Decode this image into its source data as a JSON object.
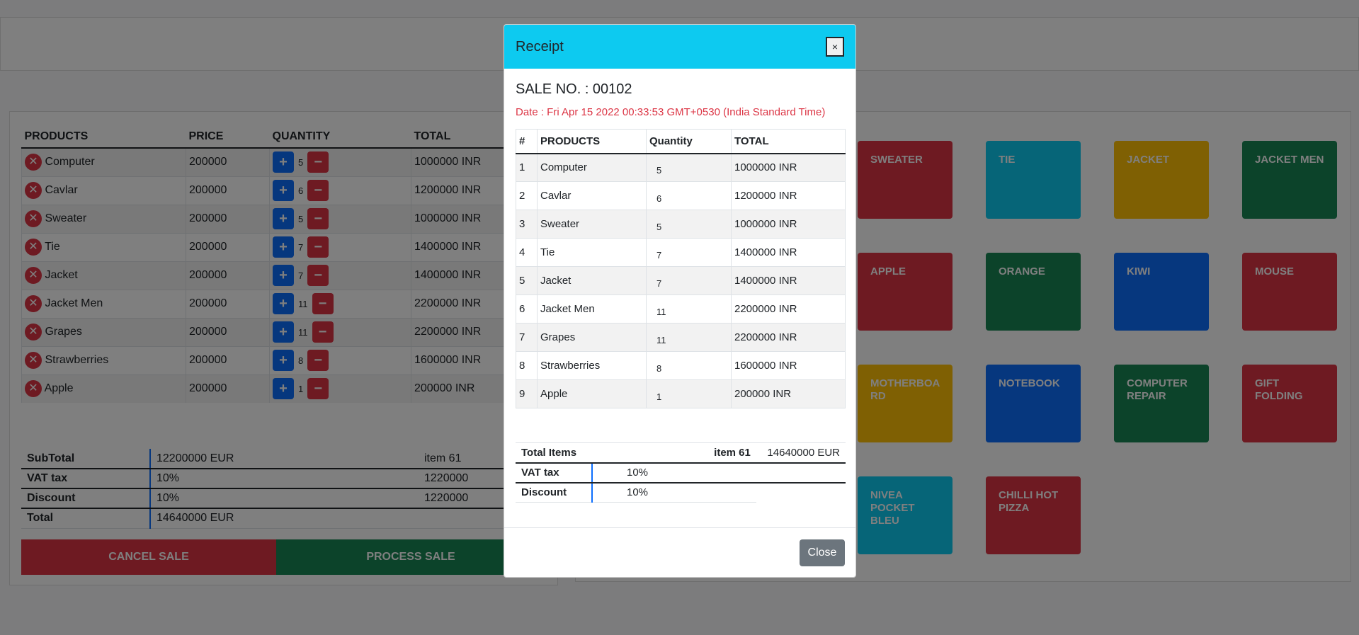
{
  "cart": {
    "headers": [
      "PRODUCTS",
      "PRICE",
      "QUANTITY",
      "TOTAL"
    ],
    "rows": [
      {
        "product": "Computer",
        "price": "200000",
        "qty": "5",
        "total": "1000000 INR"
      },
      {
        "product": "Cavlar",
        "price": "200000",
        "qty": "6",
        "total": "1200000 INR"
      },
      {
        "product": "Sweater",
        "price": "200000",
        "qty": "5",
        "total": "1000000 INR"
      },
      {
        "product": "Tie",
        "price": "200000",
        "qty": "7",
        "total": "1400000 INR"
      },
      {
        "product": "Jacket",
        "price": "200000",
        "qty": "7",
        "total": "1400000 INR"
      },
      {
        "product": "Jacket Men",
        "price": "200000",
        "qty": "11",
        "total": "2200000 INR"
      },
      {
        "product": "Grapes",
        "price": "200000",
        "qty": "11",
        "total": "2200000 INR"
      },
      {
        "product": "Strawberries",
        "price": "200000",
        "qty": "8",
        "total": "1600000 INR"
      },
      {
        "product": "Apple",
        "price": "200000",
        "qty": "1",
        "total": "200000 INR"
      }
    ],
    "icons": {
      "remove": "close-circle-icon",
      "plus": "plus-icon",
      "minus": "minus-icon"
    }
  },
  "totals": {
    "subtotal_label": "SubTotal",
    "subtotal_value": "12200000 EUR",
    "items_text": "item 61",
    "vat_label": "VAT tax",
    "vat_value": "10%",
    "vat_amount": "1220000",
    "discount_label": "Discount",
    "discount_value": "10%",
    "discount_amount": "1220000",
    "total_label": "Total",
    "total_value": "14640000 EUR"
  },
  "actions": {
    "cancel": "CANCEL SALE",
    "process": "PROCESS SALE"
  },
  "tiles": [
    {
      "label": "SWEATER",
      "color": "#dc3545"
    },
    {
      "label": "TIE",
      "color": "#0dcaf0"
    },
    {
      "label": "JACKET",
      "color": "#ffc107"
    },
    {
      "label": "JACKET MEN",
      "color": "#198754"
    },
    {
      "label": "APPLE",
      "color": "#dc3545"
    },
    {
      "label": "ORANGE",
      "color": "#198754"
    },
    {
      "label": "KIWI",
      "color": "#0d6efd"
    },
    {
      "label": "MOUSE",
      "color": "#dc3545"
    },
    {
      "label": "MOTHERBOA RD",
      "color": "#ffc107"
    },
    {
      "label": "NOTEBOOK",
      "color": "#0d6efd"
    },
    {
      "label": "COMPUTER REPAIR",
      "color": "#198754"
    },
    {
      "label": "GIFT FOLDING",
      "color": "#dc3545"
    },
    {
      "label": "NIVEA POCKET BLEU",
      "color": "#0dcaf0"
    },
    {
      "label": "CHILLI HOT PIZZA",
      "color": "#dc3545"
    }
  ],
  "modal": {
    "title": "Receipt",
    "close_x": "×",
    "sale_no": "SALE NO. : 00102",
    "date": "Date : Fri Apr 15 2022 00:33:53 GMT+0530 (India Standard Time)",
    "headers": [
      "#",
      "PRODUCTS",
      "Quantity",
      "TOTAL"
    ],
    "rows": [
      {
        "n": "1",
        "product": "Computer",
        "qty": "5",
        "total": "1000000 INR"
      },
      {
        "n": "2",
        "product": "Cavlar",
        "qty": "6",
        "total": "1200000 INR"
      },
      {
        "n": "3",
        "product": "Sweater",
        "qty": "5",
        "total": "1000000 INR"
      },
      {
        "n": "4",
        "product": "Tie",
        "qty": "7",
        "total": "1400000 INR"
      },
      {
        "n": "5",
        "product": "Jacket",
        "qty": "7",
        "total": "1400000 INR"
      },
      {
        "n": "6",
        "product": "Jacket Men",
        "qty": "11",
        "total": "2200000 INR"
      },
      {
        "n": "7",
        "product": "Grapes",
        "qty": "11",
        "total": "2200000 INR"
      },
      {
        "n": "8",
        "product": "Strawberries",
        "qty": "8",
        "total": "1600000 INR"
      },
      {
        "n": "9",
        "product": "Apple",
        "qty": "1",
        "total": "200000 INR"
      }
    ],
    "summary": {
      "total_items_label": "Total Items",
      "items_text": "item 61",
      "total_value": "14640000 EUR",
      "vat_label": "VAT tax",
      "vat_value": "10%",
      "discount_label": "Discount",
      "discount_value": "10%"
    },
    "close_button": "Close"
  }
}
